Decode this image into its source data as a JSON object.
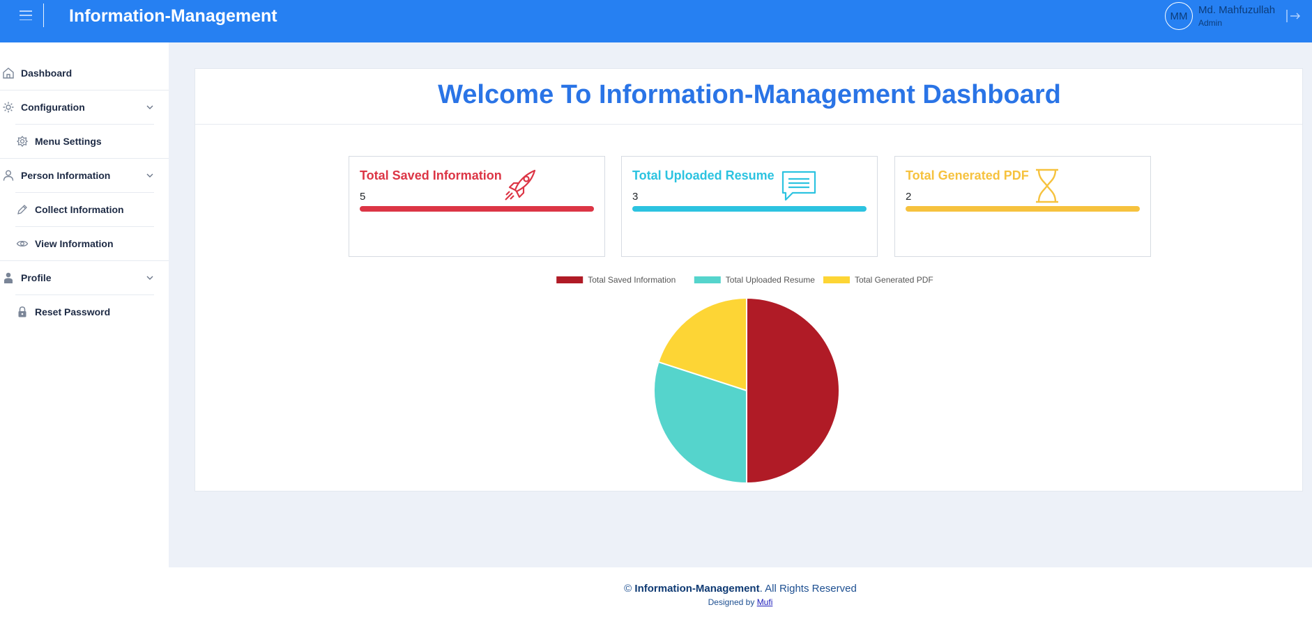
{
  "header": {
    "app_title": "Information-Management",
    "user": {
      "initials": "MM",
      "name": "Md. Mahfuzullah",
      "role": "Admin"
    }
  },
  "sidebar": {
    "items": [
      {
        "label": "Dashboard",
        "icon": "home-icon"
      },
      {
        "label": "Configuration",
        "icon": "gear-icon"
      },
      {
        "label": "Menu Settings",
        "icon": "flower-gear-icon"
      },
      {
        "label": "Person Information",
        "icon": "user-icon"
      },
      {
        "label": "Collect Information",
        "icon": "pencil-icon"
      },
      {
        "label": "View Information",
        "icon": "eye-icon"
      },
      {
        "label": "Profile",
        "icon": "person-icon"
      },
      {
        "label": "Reset Password",
        "icon": "lock-icon"
      }
    ]
  },
  "main": {
    "welcome": "Welcome To Information-Management Dashboard",
    "stats": [
      {
        "title": "Total Saved Information",
        "value": "5",
        "color": "#dc3545",
        "icon": "rocket-icon"
      },
      {
        "title": "Total Uploaded Resume",
        "value": "3",
        "color": "#2cc3e0",
        "icon": "chat-message-icon"
      },
      {
        "title": "Total Generated PDF",
        "value": "2",
        "color": "#f6c23e",
        "icon": "hourglass-icon"
      }
    ]
  },
  "chart_data": {
    "type": "pie",
    "categories": [
      "Total Saved Information",
      "Total Uploaded Resume",
      "Total Generated PDF"
    ],
    "values": [
      5,
      3,
      2
    ],
    "colors": [
      "#b01b26",
      "#55d4cc",
      "#fdd535"
    ],
    "legend": "top-center"
  },
  "footer": {
    "copyright_symbol": "©",
    "copyright_brand": "Information-Management",
    "copyright_rest": ". All Rights Reserved",
    "designed_prefix": "Designed by",
    "designer": "Mufi"
  }
}
